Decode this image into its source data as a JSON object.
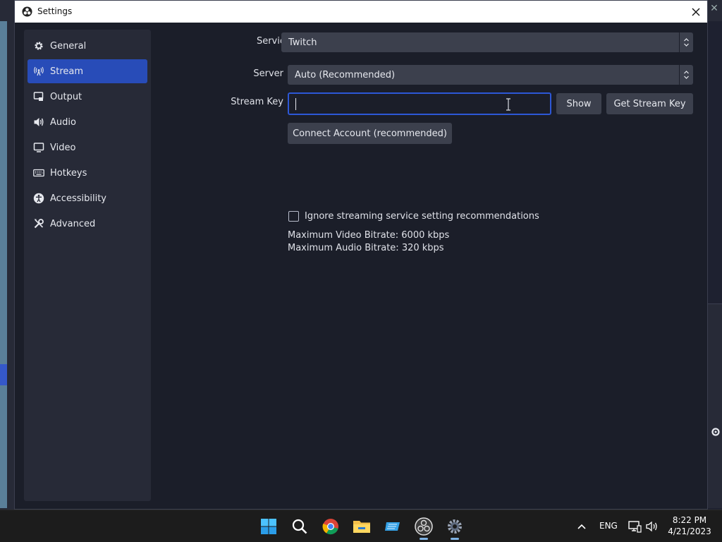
{
  "window": {
    "title": "Settings"
  },
  "sidebar": {
    "items": [
      {
        "label": "General",
        "icon": "gear-icon",
        "active": false
      },
      {
        "label": "Stream",
        "icon": "antenna-icon",
        "active": true
      },
      {
        "label": "Output",
        "icon": "output-icon",
        "active": false
      },
      {
        "label": "Audio",
        "icon": "speaker-icon",
        "active": false
      },
      {
        "label": "Video",
        "icon": "monitor-icon",
        "active": false
      },
      {
        "label": "Hotkeys",
        "icon": "keyboard-icon",
        "active": false
      },
      {
        "label": "Accessibility",
        "icon": "accessibility-icon",
        "active": false
      },
      {
        "label": "Advanced",
        "icon": "wrench-icon",
        "active": false
      }
    ]
  },
  "stream": {
    "service_label": "Service",
    "service_value": "Twitch",
    "server_label": "Server",
    "server_value": "Auto (Recommended)",
    "stream_key_label": "Stream Key",
    "stream_key_value": "",
    "show_button": "Show",
    "get_key_button": "Get Stream Key",
    "connect_button": "Connect Account (recommended)",
    "ignore_checkbox_label": "Ignore streaming service setting recommendations",
    "ignore_checked": false,
    "max_video_bitrate": "Maximum Video Bitrate: 6000 kbps",
    "max_audio_bitrate": "Maximum Audio Bitrate: 320 kbps"
  },
  "taskbar": {
    "language": "ENG",
    "time": "8:22 PM",
    "date": "4/21/2023"
  },
  "colors": {
    "accent": "#284cb8",
    "focus_border": "#2d57d6",
    "panel": "#272a37",
    "background": "#1b1e29",
    "control": "#3c404d"
  }
}
